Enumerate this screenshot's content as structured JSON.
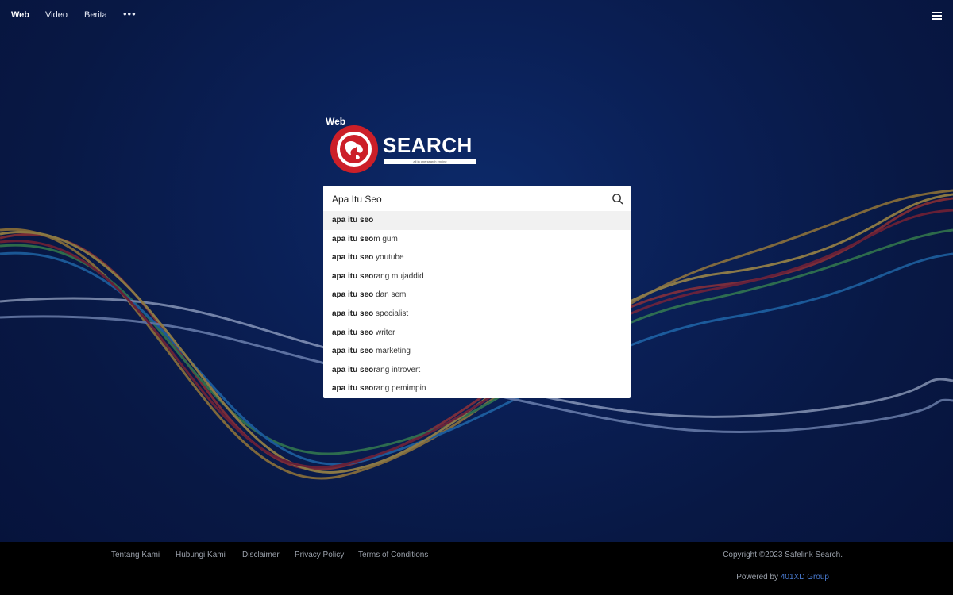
{
  "nav": {
    "items": [
      {
        "label": "Web",
        "active": true
      },
      {
        "label": "Video",
        "active": false
      },
      {
        "label": "Berita",
        "active": false
      }
    ],
    "more_label": "•••",
    "menu_icon": "hamburger-menu-icon"
  },
  "logo": {
    "prefix": "Web",
    "title": "SEARCH",
    "tagline": "all in one search engine",
    "icon": "globe-icon",
    "brand_color": "#cc1f28"
  },
  "search": {
    "value": "Apa Itu Seo",
    "placeholder": "",
    "button_icon": "search-icon"
  },
  "suggestions": [
    {
      "bold": "apa itu seo",
      "rest": ""
    },
    {
      "bold": "apa itu seo",
      "rest": "m gum"
    },
    {
      "bold": "apa itu seo",
      "rest": " youtube"
    },
    {
      "bold": "apa itu seo",
      "rest": "rang mujaddid"
    },
    {
      "bold": "apa itu seo",
      "rest": " dan sem"
    },
    {
      "bold": "apa itu seo",
      "rest": " specialist"
    },
    {
      "bold": "apa itu seo",
      "rest": " writer"
    },
    {
      "bold": "apa itu seo",
      "rest": " marketing"
    },
    {
      "bold": "apa itu seo",
      "rest": "rang introvert"
    },
    {
      "bold": "apa itu seo",
      "rest": "rang pemimpin"
    }
  ],
  "footer": {
    "links": [
      "Tentang Kami",
      "Hubungi Kami",
      "Disclaimer",
      "Privacy Policy",
      "Terms of Conditions"
    ],
    "copyright": "Copyright ©2023 Safelink Search.",
    "powered_prefix": "Powered by ",
    "powered_link": "401XD Group",
    "link_color": "#4a7bd0"
  }
}
